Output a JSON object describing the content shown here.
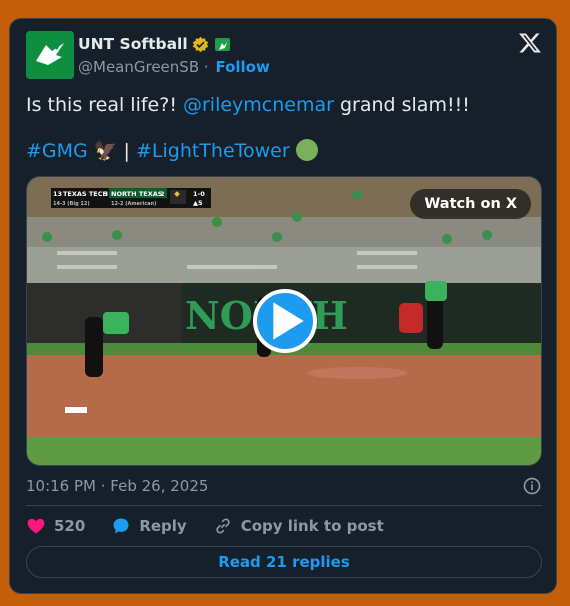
{
  "author": {
    "display_name": "UNT Softball",
    "handle": "@MeanGreenSB",
    "separator": "·",
    "follow_label": "Follow",
    "avatar_icon": "unt-eagle-logo",
    "verified_icon": "gold-verified-badge",
    "affiliate_icon": "unt-affiliate-badge"
  },
  "tweet": {
    "text_line1_prefix": "Is this real life?! ",
    "mention": "@rileymcnemar",
    "text_line1_suffix": " grand slam!!!",
    "hashtag1": "#GMG",
    "eagle_emoji": "🦅",
    "pipe": " | ",
    "hashtag2": "#LightTheTower",
    "green_circle_icon": "green-circle-emoji"
  },
  "media": {
    "watch_label": "Watch on X",
    "scoreboard": {
      "team1": "TEXAS TECH",
      "team1_rank": "13",
      "team1_score": "5",
      "team1_record": "14-3 (Big 12)",
      "team2": "NORTH TEXAS",
      "team2_score": "2",
      "team2_record": "12-2 (American)",
      "count": "1-0",
      "inning": "▲5"
    },
    "wall_text": "NORTH"
  },
  "meta": {
    "timestamp": "10:16 PM · Feb 26, 2025"
  },
  "actions": {
    "likes_count": "520",
    "reply_label": "Reply",
    "copy_label": "Copy link to post"
  },
  "replies_button": "Read 21 replies",
  "colors": {
    "page_bg": "#c45e08",
    "card_bg": "#15202b",
    "link": "#1d9bf0",
    "like": "#f91880",
    "muted": "#8b98a5"
  }
}
